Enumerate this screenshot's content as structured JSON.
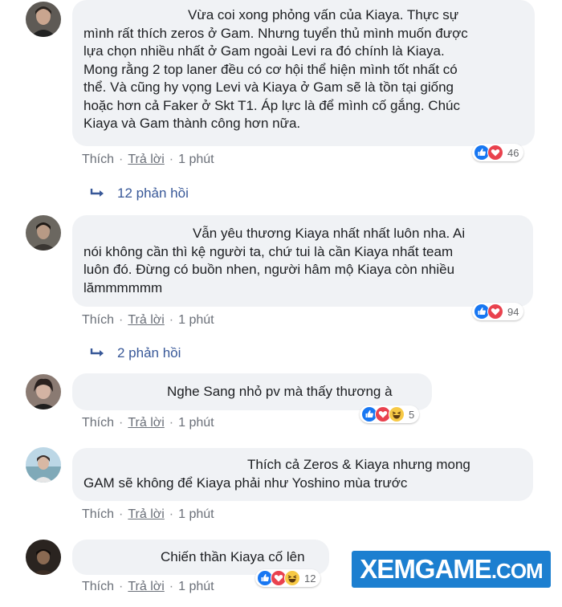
{
  "colors": {
    "bubble": "#f0f2f5",
    "link": "#385898",
    "meta": "#6b7079",
    "like": "#1877f2",
    "love": "#e9424e",
    "haha": "#f7c945",
    "watermark": "#1c7fd0"
  },
  "comments": [
    {
      "text": "Vừa coi xong phỏng vấn của Kiaya. Thực sự mình rất thích zeros ở Gam. Nhưng tuyển thủ mình muốn được lựa chọn nhiều nhất ở Gam ngoài Levi ra đó chính là Kiaya. Mong rằng 2 top laner đều có cơ hội thể hiện mình tốt nhất có thể. Và cũng hy vọng Levi và Kiaya ở Gam sẽ là tồn tại giống hoặc hơn cả Faker ở Skt T1. Áp lực là để mình cố gắng. Chúc Kiaya và Gam thành công hơn nữa.",
      "lines": [
        "Vừa coi xong phỏng vấn của Kiaya. Thực sự",
        "mình rất thích zeros ở Gam. Nhưng tuyển thủ mình muốn được",
        "lựa chọn nhiều nhất ở Gam ngoài Levi ra đó chính là Kiaya.",
        "Mong rằng 2 top laner đều có cơ hội thể hiện mình tốt nhất có",
        "thể. Và cũng hy vọng Levi và Kiaya ở Gam sẽ là tồn tại giống",
        "hoặc hơn cả Faker ở Skt T1. Áp lực là để mình cố gắng. Chúc",
        "Kiaya và Gam thành công hơn nữa."
      ],
      "like": "Thích",
      "reply": "Trả lời",
      "time": "1 phút",
      "reactions": [
        "like",
        "love"
      ],
      "reaction_count": "46",
      "replies": "12 phản hồi"
    },
    {
      "lines": [
        "Vẫn yêu thương Kiaya nhất nhất luôn nha. Ai",
        "nói không cần thì kệ người ta, chứ tui là cần Kiaya nhất team",
        "luôn đó. Đừng có buồn nhen, người hâm mộ Kiaya còn nhiều",
        "lămmmmmm"
      ],
      "like": "Thích",
      "reply": "Trả lời",
      "time": "1 phút",
      "reactions": [
        "like",
        "love"
      ],
      "reaction_count": "94",
      "replies": "2 phản hồi"
    },
    {
      "lines": [
        "Nghe Sang nhỏ pv mà thấy thương à"
      ],
      "like": "Thích",
      "reply": "Trả lời",
      "time": "1 phút",
      "reactions": [
        "like",
        "love",
        "haha"
      ],
      "reaction_count": "5"
    },
    {
      "lines": [
        "Thích cả Zeros & Kiaya nhưng mong",
        "GAM sẽ không để Kiaya phải như Yoshino mùa trước"
      ],
      "like": "Thích",
      "reply": "Trả lời",
      "time": "1 phút"
    },
    {
      "lines": [
        "Chiến thần Kiaya cố lên"
      ],
      "like": "Thích",
      "reply": "Trả lời",
      "time": "1 phút",
      "reactions": [
        "like",
        "love",
        "haha"
      ],
      "reaction_count": "12"
    }
  ],
  "watermark": {
    "main": "XEMGAME",
    "suffix": ".COM"
  }
}
